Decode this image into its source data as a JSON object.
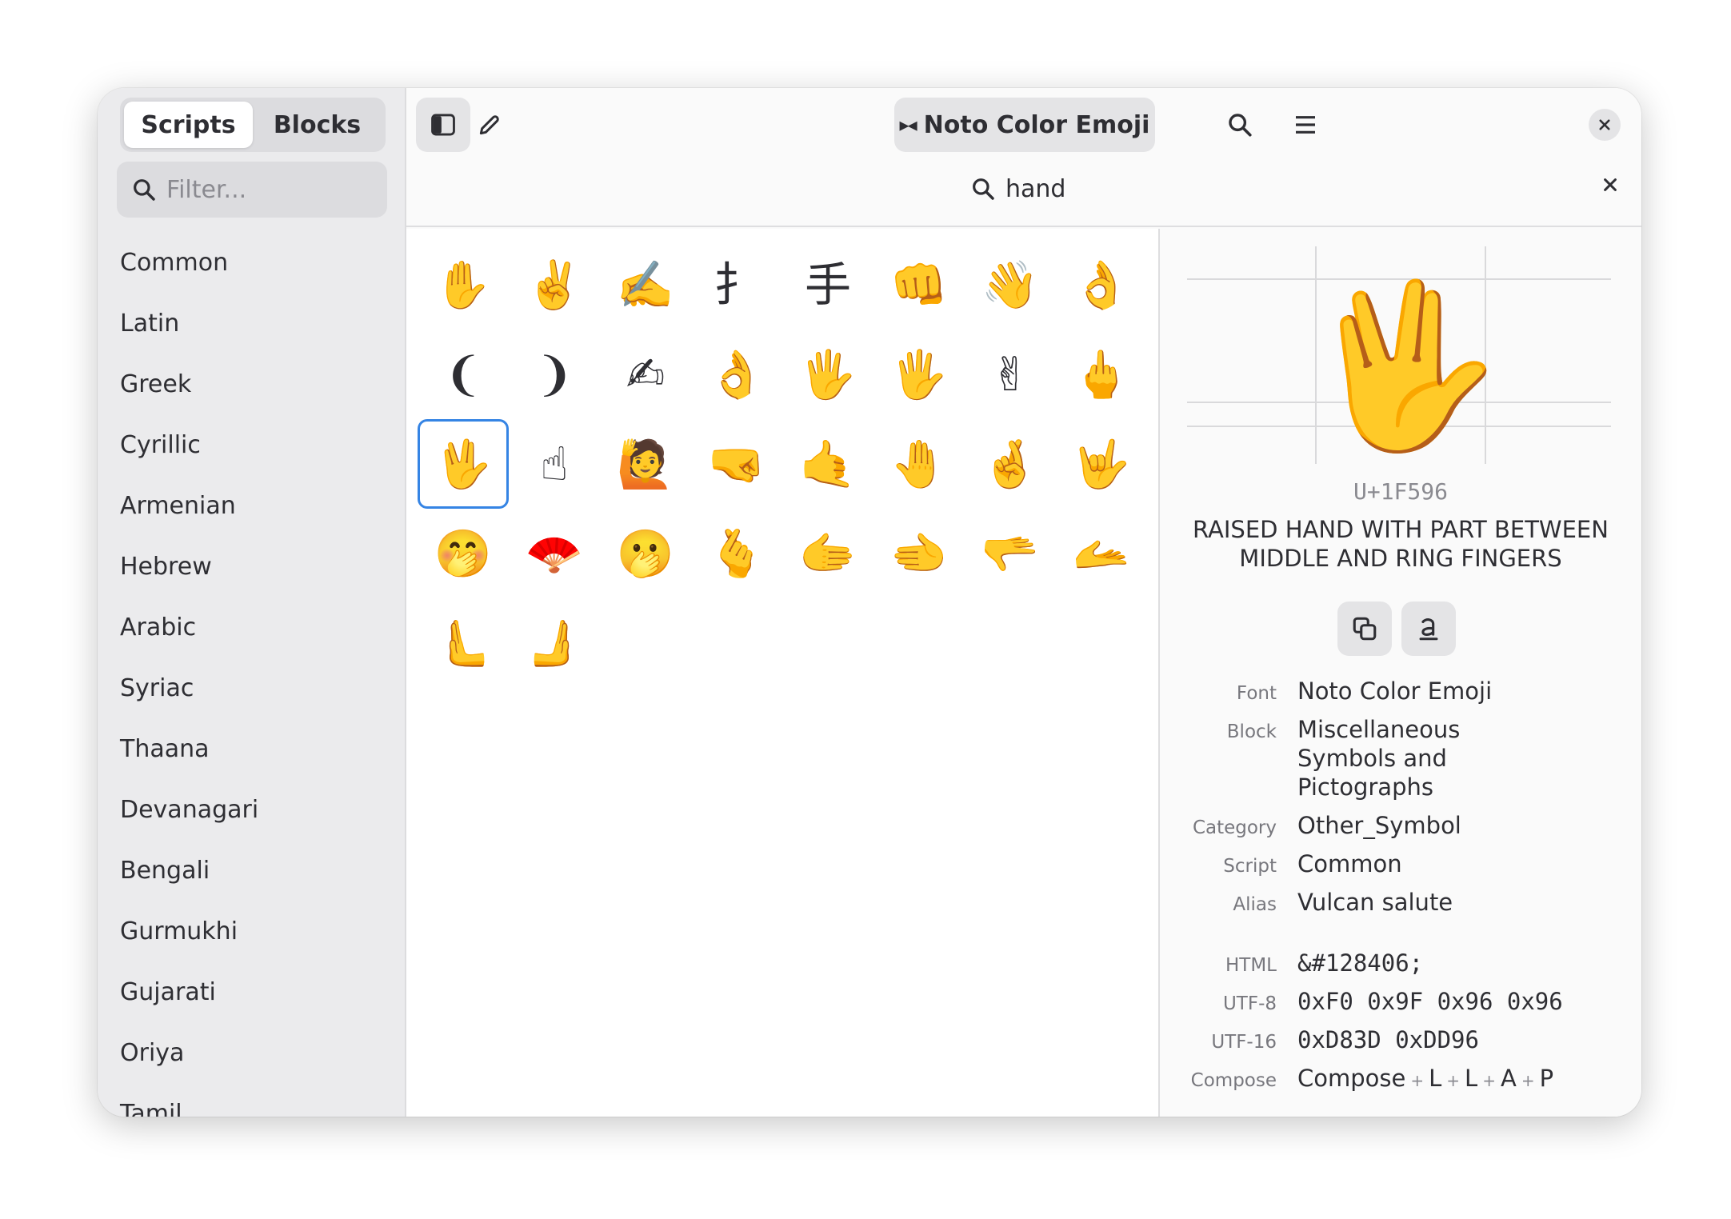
{
  "sidebar": {
    "tabs": [
      {
        "label": "Scripts",
        "active": true
      },
      {
        "label": "Blocks",
        "active": false
      }
    ],
    "filter_placeholder": "Filter...",
    "scripts": [
      "Common",
      "Latin",
      "Greek",
      "Cyrillic",
      "Armenian",
      "Hebrew",
      "Arabic",
      "Syriac",
      "Thaana",
      "Devanagari",
      "Bengali",
      "Gurmukhi",
      "Gujarati",
      "Oriya",
      "Tamil"
    ]
  },
  "header": {
    "font_button": "Noto Color Emoji",
    "font_glyph": "▸◂",
    "search_value": "hand"
  },
  "grid": {
    "glyphs": [
      "✋",
      "✌️",
      "✍️",
      "扌",
      "手",
      "👊",
      "👋",
      "👌",
      "❨",
      "❩",
      "✍",
      "👌",
      "🖐️",
      "🖐",
      "✌",
      "🖕",
      "🖖",
      "☝",
      "🙋",
      "🤜",
      "🤙",
      "🤚",
      "🤞",
      "🤟",
      "🤭",
      "🪭",
      "🫢",
      "🫰",
      "🫱",
      "🫲",
      "🫳",
      "🫴",
      "🫷",
      "🫸"
    ],
    "selected_index": 16
  },
  "details": {
    "glyph": "🖖",
    "codepoint": "U+1F596",
    "name": "RAISED HAND WITH PART BETWEEN MIDDLE AND RING FINGERS",
    "props": [
      {
        "label": "Font",
        "value": "Noto Color Emoji"
      },
      {
        "label": "Block",
        "value": "Miscellaneous Symbols and Pictographs"
      },
      {
        "label": "Category",
        "value": "Other_Symbol"
      },
      {
        "label": "Script",
        "value": "Common"
      },
      {
        "label": "Alias",
        "value": "Vulcan salute"
      }
    ],
    "encodings": [
      {
        "label": "HTML",
        "value": "&#128406;"
      },
      {
        "label": "UTF-8",
        "value": "0xF0 0x9F 0x96 0x96"
      },
      {
        "label": "UTF-16",
        "value": "0xD83D 0xDD96"
      }
    ],
    "compose": {
      "label": "Compose",
      "keys": [
        "Compose",
        "L",
        "L",
        "A",
        "P"
      ]
    }
  },
  "colors": {
    "accent": "#3584e4",
    "sidebar_bg": "#ebebed",
    "window_bg": "#fafafa"
  }
}
